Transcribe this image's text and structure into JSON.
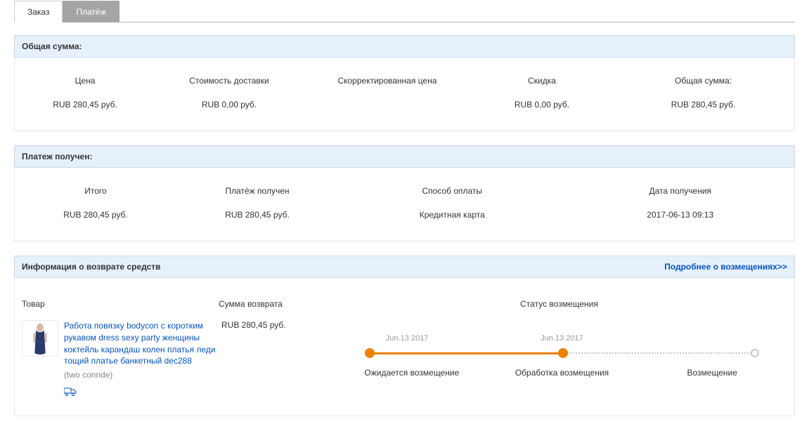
{
  "tabs": {
    "order": "Заказ",
    "payment": "Платёж"
  },
  "panel_total": {
    "title": "Общая сумма:",
    "headers": {
      "price": "Цена",
      "shipping": "Стоимость доставки",
      "adjusted": "Скорректированная цена",
      "discount": "Скидка",
      "total": "Общая сумма:"
    },
    "values": {
      "price": "RUB 280,45 руб.",
      "shipping": "RUB 0,00 руб.",
      "adjusted": "",
      "discount": "RUB 0,00 руб.",
      "total": "RUB 280,45 руб."
    }
  },
  "panel_paid": {
    "title": "Платеж получен:",
    "headers": {
      "grand": "Итого",
      "received": "Платёж получен",
      "method": "Способ оплаты",
      "date": "Дата получения"
    },
    "values": {
      "grand": "RUB 280,45 руб.",
      "received": "RUB 280,45 руб.",
      "method": "Кредитная карта",
      "date": "2017-06-13 09:13"
    }
  },
  "panel_refund": {
    "title": "Информация о возврате средств",
    "more_link": "Подробнее о возмещениях>>",
    "headers": {
      "product": "Товар",
      "amount": "Сумма возврата",
      "status": "Статус возмещения"
    },
    "product": {
      "title": "Работа повязку bodycon с коротким рукавом dress sexy party женщины коктейль карандаш колен платья леди тощий платье банкетный dec288",
      "seller": "(two conride)"
    },
    "amount": "RUB 280,45 руб.",
    "timeline": {
      "dates": {
        "d1": "Jun.13 2017",
        "d2": "Jun.13 2017",
        "d3": ""
      },
      "labels": {
        "l1": "Ожидается возмещение",
        "l2": "Обработка возмещения",
        "l3": "Возмещение"
      }
    }
  }
}
